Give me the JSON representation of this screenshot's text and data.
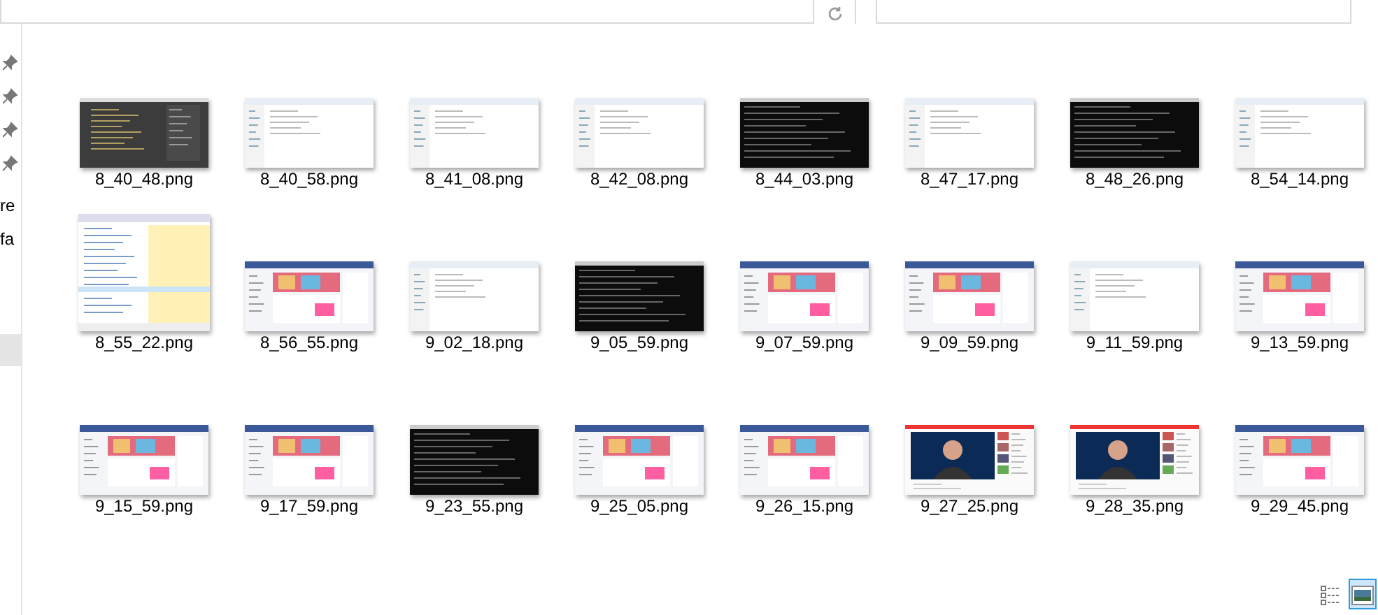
{
  "sidebar": {
    "pins": [
      {
        "kind": "pin"
      },
      {
        "kind": "pin"
      },
      {
        "kind": "pin"
      },
      {
        "kind": "pin"
      }
    ],
    "items": [
      {
        "label": "re",
        "selected": false
      },
      {
        "label": "fa",
        "selected": false
      },
      {
        "selected": true
      }
    ]
  },
  "files": [
    {
      "name": "8_40_48.png",
      "kind": "editor"
    },
    {
      "name": "8_40_58.png",
      "kind": "window"
    },
    {
      "name": "8_41_08.png",
      "kind": "window"
    },
    {
      "name": "8_42_08.png",
      "kind": "window"
    },
    {
      "name": "8_44_03.png",
      "kind": "terminal"
    },
    {
      "name": "8_47_17.png",
      "kind": "window"
    },
    {
      "name": "8_48_26.png",
      "kind": "terminal"
    },
    {
      "name": "8_54_14.png",
      "kind": "window"
    },
    {
      "name": "8_55_22.png",
      "kind": "table"
    },
    {
      "name": "8_56_55.png",
      "kind": "web"
    },
    {
      "name": "9_02_18.png",
      "kind": "window"
    },
    {
      "name": "9_05_59.png",
      "kind": "terminal"
    },
    {
      "name": "9_07_59.png",
      "kind": "web"
    },
    {
      "name": "9_09_59.png",
      "kind": "web"
    },
    {
      "name": "9_11_59.png",
      "kind": "window"
    },
    {
      "name": "9_13_59.png",
      "kind": "web"
    },
    {
      "name": "9_15_59.png",
      "kind": "web"
    },
    {
      "name": "9_17_59.png",
      "kind": "web"
    },
    {
      "name": "9_23_55.png",
      "kind": "terminal"
    },
    {
      "name": "9_25_05.png",
      "kind": "web"
    },
    {
      "name": "9_26_15.png",
      "kind": "web"
    },
    {
      "name": "9_27_25.png",
      "kind": "video"
    },
    {
      "name": "9_28_35.png",
      "kind": "video"
    },
    {
      "name": "9_29_45.png",
      "kind": "web"
    }
  ],
  "view_buttons": [
    {
      "kind": "details",
      "selected": false
    },
    {
      "kind": "large-icons",
      "selected": true
    }
  ]
}
